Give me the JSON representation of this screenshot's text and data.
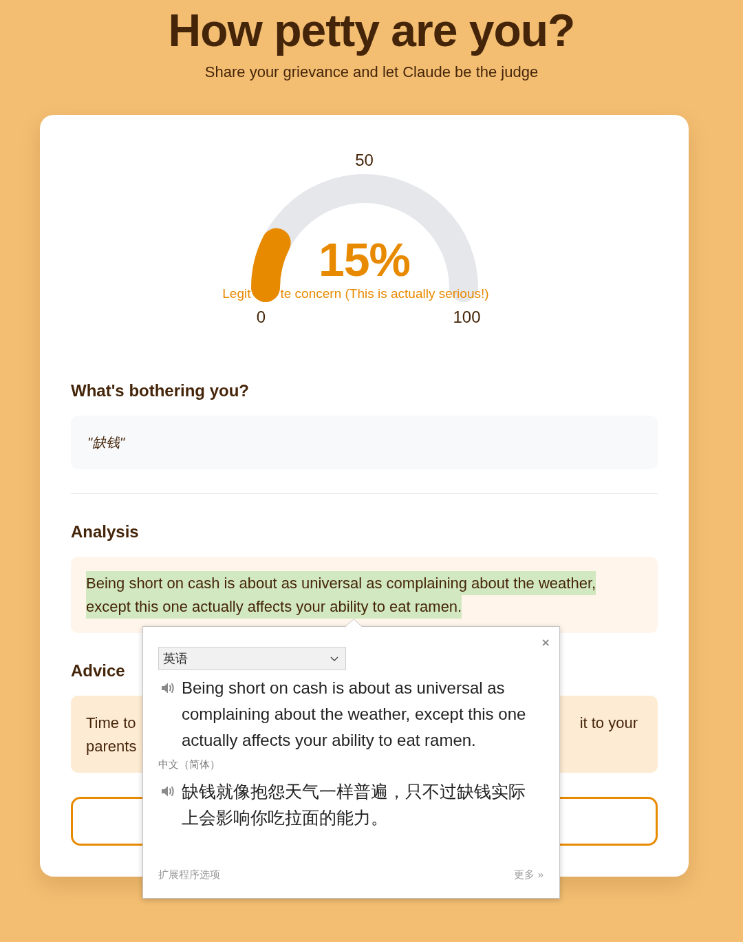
{
  "header": {
    "title": "How petty are you?",
    "subtitle": "Share your grievance and let Claude be the judge"
  },
  "gauge": {
    "level": 0.15,
    "score": "15%",
    "tick_labels": [
      {
        "kind": "mid",
        "text": "50"
      },
      {
        "kind": "min",
        "text": "0"
      },
      {
        "kind": "max",
        "text": "100"
      }
    ],
    "verdict_visible_parts": [
      "Legit",
      "te concern (This is actually serious!)"
    ]
  },
  "grievance": {
    "heading": "What's bothering you?",
    "quote": "\"缺钱\""
  },
  "analysis": {
    "heading": "Analysis",
    "text": "Being short on cash is about as universal as complaining about the weather, except this one actually affects your ability to eat ramen.",
    "highlighted": true
  },
  "advice": {
    "heading": "Advice",
    "visible_parts": [
      "Time to",
      "it to your",
      "parents"
    ]
  },
  "translation_popup": {
    "close": "×",
    "source_language": "英语",
    "source_text": "Being short on cash is about as universal as complaining about the weather, except this one actually affects your ability to eat ramen.",
    "target_language": "中文（简体）",
    "target_text": "缺钱就像抱怨天气一样普遍，只不过缺钱实际上会影响你吃拉面的能力。",
    "options_link": "扩展程序选项",
    "more_link": "更多 »"
  }
}
